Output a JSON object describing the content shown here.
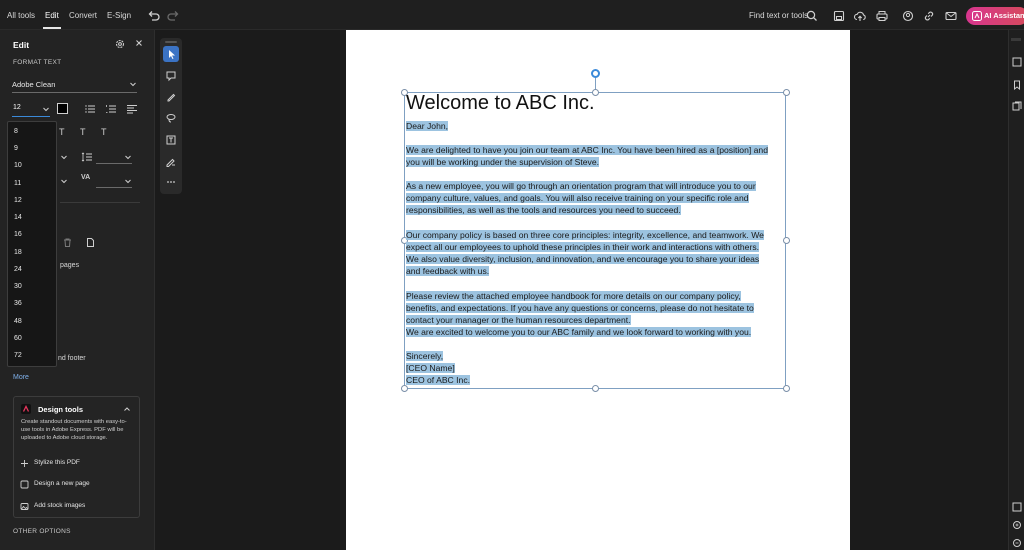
{
  "topbar": {
    "tabs": [
      "All tools",
      "Edit",
      "Convert",
      "E-Sign"
    ],
    "active_tab": "Edit",
    "find_label": "Find text or tools",
    "ai_label": "AI Assistant"
  },
  "edit_panel": {
    "title": "Edit",
    "format_text_label": "FORMAT TEXT",
    "font_family": "Adobe Clean",
    "font_size_value": "12",
    "font_size_options": [
      "8",
      "9",
      "10",
      "11",
      "12",
      "14",
      "16",
      "18",
      "24",
      "30",
      "36",
      "48",
      "60",
      "72"
    ],
    "pages_fragment": "pages",
    "footer_fragment": "nd footer",
    "more_label": "More",
    "other_options_label": "OTHER OPTIONS"
  },
  "design_tools": {
    "title": "Design tools",
    "description_lines": [
      "Create standout documents with easy-to-",
      "use tools in Adobe Express. PDF will be",
      "uploaded to Adobe cloud storage."
    ],
    "actions": [
      "Stylize this PDF",
      "Design a new page",
      "Add stock images"
    ]
  },
  "document": {
    "title": "Welcome to ABC Inc.",
    "lines": [
      "Dear John,",
      "",
      "We are delighted to have you join our team at ABC Inc. You have been hired as a [position] and",
      "you will be working under the supervision of Steve.",
      "",
      "As a new employee, you will go through an orientation program that will introduce you to our",
      "company culture, values, and goals. You will also receive training on your specific role and",
      "responsibilities, as well as the tools and resources you need to succeed.",
      "",
      "Our company policy is based on three core principles: integrity, excellence, and teamwork. We",
      "expect all our employees to uphold these principles in their work and interactions with others.",
      "We also value diversity, inclusion, and innovation, and we encourage you to share your ideas",
      "and feedback with us.",
      "",
      "Please review the attached employee handbook for more details on our company policy,",
      "benefits, and expectations. If you have any questions or concerns, please do not hesitate to",
      "contact your manager or the human resources department.",
      "We are excited to welcome you to our ABC family and we look forward to working with you.",
      "",
      "Sincerely,",
      "[CEO Name]",
      "CEO of ABC Inc."
    ]
  },
  "colors": {
    "selection": "#9cc3e0",
    "accent": "#3b8ad9",
    "ai_gradient_start": "#d8368f"
  }
}
